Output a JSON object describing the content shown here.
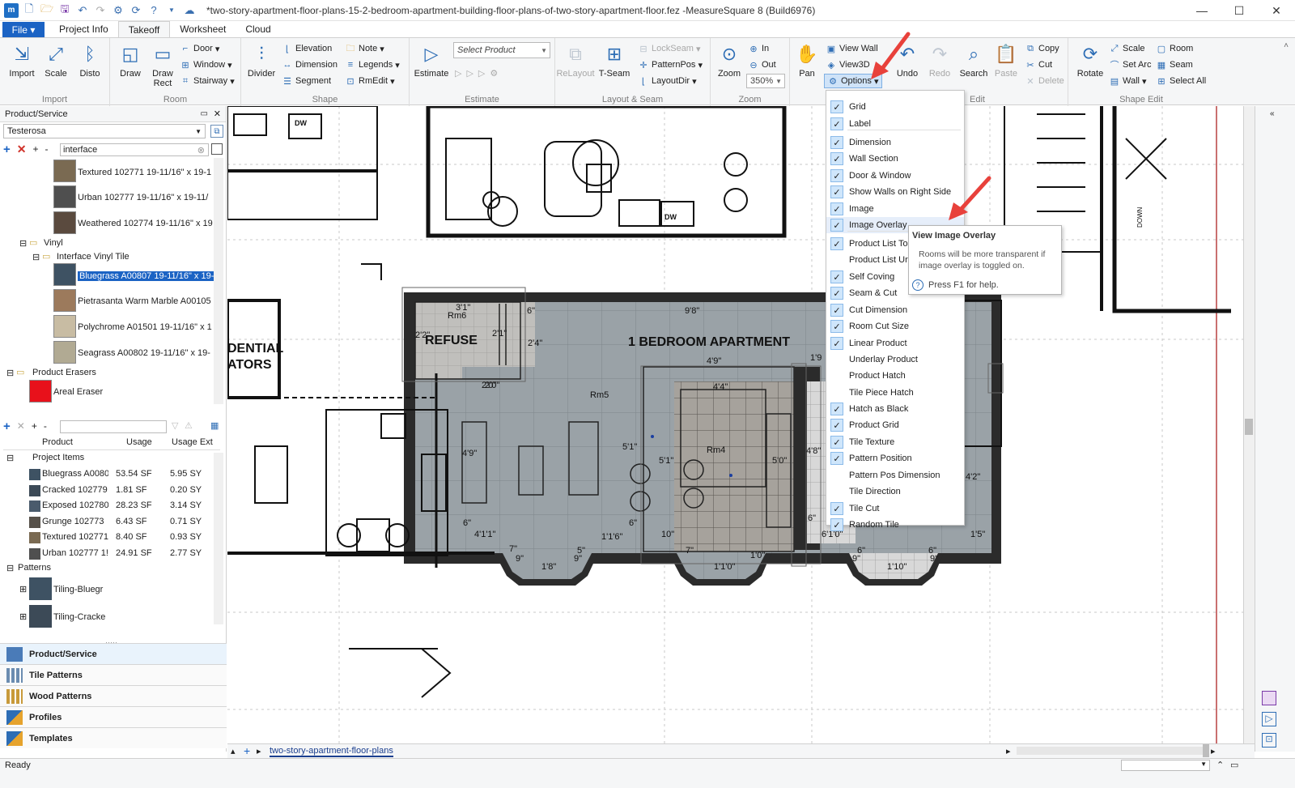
{
  "window": {
    "title": "*two-story-apartment-floor-plans-15-2-bedroom-apartment-building-floor-plans-of-two-story-apartment-floor.fez -MeasureSquare 8 (Build6976)",
    "minimize": "—",
    "maximize": "☐",
    "close": "✕"
  },
  "tabs": {
    "file": "File",
    "items": [
      "Project Info",
      "Takeoff",
      "Worksheet",
      "Cloud"
    ],
    "active": "Takeoff"
  },
  "ribbon": {
    "import": {
      "import": "Import",
      "scale": "Scale",
      "disto": "Disto",
      "group": "Import"
    },
    "room": {
      "draw": "Draw",
      "draw_rect": "Draw\nRect",
      "door": "Door",
      "window": "Window",
      "stairway": "Stairway",
      "group": "Room"
    },
    "shape": {
      "divider": "Divider",
      "elevation": "Elevation",
      "dimension": "Dimension",
      "segment": "Segment",
      "note": "Note",
      "legends": "Legends",
      "rmedit": "RmEdit",
      "group": "Shape"
    },
    "estimate": {
      "estimate": "Estimate",
      "select_product": "Select Product",
      "group": "Estimate"
    },
    "layout": {
      "relayout": "ReLayout",
      "tseam": "T-Seam",
      "lockseam": "LockSeam",
      "patternpos": "PatternPos",
      "layoutdir": "LayoutDir",
      "group": "Layout & Seam"
    },
    "zoom": {
      "zoom": "Zoom",
      "in": "In",
      "out": "Out",
      "level": "350%",
      "group": "Zoom"
    },
    "edit": {
      "pan": "Pan",
      "view_wall": "View Wall",
      "view3d": "View3D",
      "options": "Options",
      "undo": "Undo",
      "redo": "Redo",
      "search": "Search",
      "paste": "Paste",
      "copy": "Copy",
      "cut": "Cut",
      "delete": "Delete",
      "group": "Edit"
    },
    "shape_edit": {
      "rotate": "Rotate",
      "scale": "Scale",
      "set_arc": "Set Arc",
      "wall": "Wall",
      "room": "Room",
      "seam": "Seam",
      "select_all": "Select All",
      "group": "Shape Edit"
    }
  },
  "left_panel": {
    "header": "Product/Service",
    "manufacturer": "Testerosa",
    "filter": "interface",
    "tree": [
      {
        "label": "Textured 102771 19-11/16\" x 19-1",
        "color": "#7a6a52"
      },
      {
        "label": "Urban 102777 19-11/16\" x 19-11/",
        "color": "#4f4f4f"
      },
      {
        "label": "Weathered 102774 19-11/16\" x 19",
        "color": "#5a4a3e"
      },
      {
        "label": "Vinyl"
      },
      {
        "label": "Interface Vinyl Tile"
      },
      {
        "label": "Bluegrass A00807 19-11/16\" x 19-",
        "color": "#3e5263"
      },
      {
        "label": "Pietrasanta Warm Marble A00105",
        "color": "#9c7a5c"
      },
      {
        "label": "Polychrome A01501 19-11/16\" x 1",
        "color": "#c8bca3"
      },
      {
        "label": "Seagrass A00802 19-11/16\" x 19-",
        "color": "#b1aa93"
      },
      {
        "label": "Product Erasers"
      },
      {
        "label": "Areal Eraser",
        "color": "#e8111b"
      }
    ],
    "table": {
      "columns": [
        "Product",
        "Usage",
        "Usage Ext"
      ],
      "group": "Project Items",
      "rows": [
        {
          "name": "Bluegrass A0080",
          "usage": "53.54 SF",
          "ext": "5.95 SY",
          "color": "#3e5263"
        },
        {
          "name": "Cracked 102779",
          "usage": "1.81 SF",
          "ext": "0.20 SY",
          "color": "#3c4a57"
        },
        {
          "name": "Exposed 102780",
          "usage": "28.23 SF",
          "ext": "3.14 SY",
          "color": "#4a5b6c"
        },
        {
          "name": "Grunge 102773",
          "usage": "6.43 SF",
          "ext": "0.71 SY",
          "color": "#57514a"
        },
        {
          "name": "Textured 102771",
          "usage": "8.40 SF",
          "ext": "0.93 SY",
          "color": "#7a6a52"
        },
        {
          "name": "Urban 102777 1!",
          "usage": "24.91 SF",
          "ext": "2.77 SY",
          "color": "#4f4f4f"
        }
      ],
      "patterns_group": "Patterns",
      "patterns": [
        {
          "name": "Tiling-Bluegr",
          "color": "#3e5263"
        },
        {
          "name": "Tiling-Cracke",
          "color": "#3c4a57"
        }
      ]
    },
    "nav": [
      "Product/Service",
      "Tile Patterns",
      "Wood Patterns",
      "Profiles",
      "Templates"
    ]
  },
  "canvas": {
    "room_label": "1 BEDROOM APARTMENT",
    "labels": {
      "rm6": "Rm6",
      "refuse": "REFUSE",
      "rm5": "Rm5",
      "rm4": "Rm4",
      "dential": "DENTIAL",
      "ators": "ATORS",
      "dw": "DW",
      "down": "DOWN"
    },
    "dims": [
      "3'1\"",
      "6\"",
      "9'8\"",
      "2'2\"",
      "2'1\"",
      "2'4\"",
      "4'9\"",
      "1'9",
      "2'0\"",
      "2'0\"",
      "4'4\"",
      "4'9\"",
      "5'1\"",
      "5'1\"",
      "5'0\"",
      "4'8\"",
      "4'2\"",
      "6\"",
      "6\"",
      "6\"",
      "4'1'1\"",
      "1'1'6\"",
      "10\"",
      "6'1'0\"",
      "1'5\"",
      "7\"",
      "9\"",
      "1'8\"",
      "9\"",
      "5\"",
      "7\"",
      "1'0\"",
      "1'1'0\"",
      "6\"",
      "9\"",
      "1'10\"",
      "6\"",
      "9\""
    ]
  },
  "options_menu": [
    {
      "label": "Grid",
      "checked": true
    },
    {
      "label": "Label",
      "checked": true
    },
    {
      "label": "Dimension",
      "checked": true
    },
    {
      "label": "Wall Section",
      "checked": true
    },
    {
      "label": "Door & Window",
      "checked": true
    },
    {
      "label": "Show Walls on Right Side",
      "checked": true
    },
    {
      "label": "Image",
      "checked": true
    },
    {
      "label": "Image Overlay",
      "checked": true
    },
    {
      "label": "Product List To",
      "checked": true
    },
    {
      "label": "Product List Ur",
      "checked": false
    },
    {
      "label": "Self Coving",
      "checked": true
    },
    {
      "label": "Seam & Cut",
      "checked": true
    },
    {
      "label": "Cut Dimension",
      "checked": true
    },
    {
      "label": "Room Cut Size",
      "checked": true
    },
    {
      "label": "Linear Product",
      "checked": true
    },
    {
      "label": "Underlay Product",
      "checked": false
    },
    {
      "label": "Product Hatch",
      "checked": false
    },
    {
      "label": "Tile Piece Hatch",
      "checked": false
    },
    {
      "label": "Hatch as Black",
      "checked": true
    },
    {
      "label": "Product Grid",
      "checked": true
    },
    {
      "label": "Tile Texture",
      "checked": true
    },
    {
      "label": "Pattern Position",
      "checked": true
    },
    {
      "label": "Pattern Pos Dimension",
      "checked": false
    },
    {
      "label": "Tile Direction",
      "checked": false
    },
    {
      "label": "Tile Cut",
      "checked": true
    },
    {
      "label": "Random Tile",
      "checked": true
    }
  ],
  "tooltip": {
    "title": "View Image Overlay",
    "body": "Rooms will be more transparent if image overlay is toggled on.",
    "help": "Press F1 for help."
  },
  "bottom": {
    "sheet_tab": "two-story-apartment-floor-plans",
    "status": "Ready"
  },
  "colors": {
    "accent": "#1b63c4",
    "arrow": "#e8413b",
    "room_fill": "#9aa1a6"
  }
}
